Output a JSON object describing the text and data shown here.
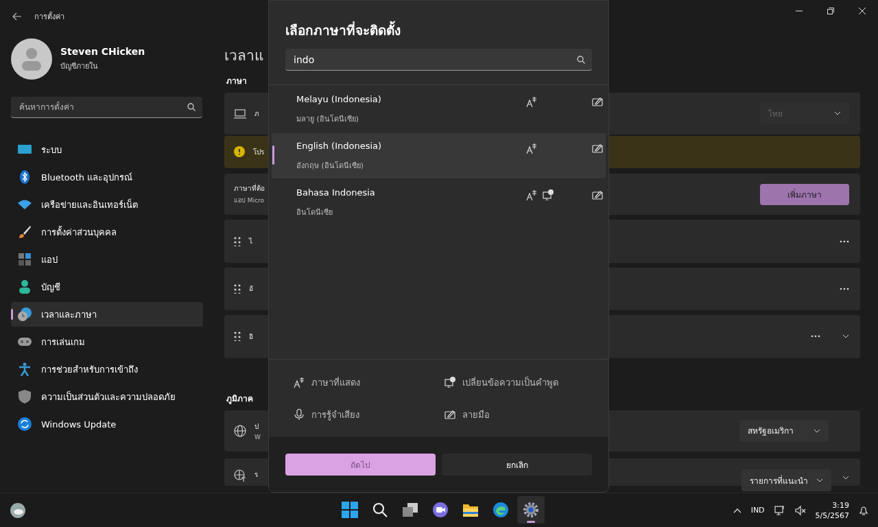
{
  "window": {
    "title": "การตั้งค่า"
  },
  "account": {
    "name": "Steven CHicken",
    "type": "บัญชีภายใน"
  },
  "search": {
    "placeholder": "ค้นหาการตั้งค่า"
  },
  "nav": [
    {
      "kind": "system",
      "label": "ระบบ",
      "selected": false
    },
    {
      "kind": "bluetooth",
      "label": "Bluetooth และอุปกรณ์",
      "selected": false
    },
    {
      "kind": "network",
      "label": "เครือข่ายและอินเทอร์เน็ต",
      "selected": false
    },
    {
      "kind": "personalize",
      "label": "การตั้งค่าส่วนบุคคล",
      "selected": false
    },
    {
      "kind": "apps",
      "label": "แอป",
      "selected": false
    },
    {
      "kind": "accounts",
      "label": "บัญชี",
      "selected": false
    },
    {
      "kind": "time",
      "label": "เวลาและภาษา",
      "selected": true
    },
    {
      "kind": "gaming",
      "label": "การเล่นเกม",
      "selected": false
    },
    {
      "kind": "accessibility",
      "label": "การช่วยสำหรับการเข้าถึง",
      "selected": false
    },
    {
      "kind": "privacy",
      "label": "ความเป็นส่วนตัวและความปลอดภัย",
      "selected": false
    },
    {
      "kind": "update",
      "label": "Windows Update",
      "selected": false
    }
  ],
  "page": {
    "title": "เวลาแ",
    "language_header": "ภาษา",
    "display_row": {
      "title": "ภ",
      "dropdown": {
        "value": "ไทย",
        "disabled": true
      }
    },
    "warning": {
      "text": "โปร"
    },
    "preferred": {
      "title": "ภาษาที่ต้อ",
      "subtitle": "แอป Micro",
      "button": "เพิ่มภาษา"
    },
    "languages": [
      {
        "title": "ไ",
        "expandable": false
      },
      {
        "title": "อั",
        "expandable": false
      },
      {
        "title": "อิ",
        "expandable": true
      }
    ],
    "region_header": "ภูมิภาค",
    "region_rows": [
      {
        "kind": "globe",
        "title": "ป",
        "subtitle": "W",
        "value": "สหรัฐอเมริกา",
        "expandable": false
      },
      {
        "kind": "format",
        "title": "ร",
        "value": "รายการที่แนะนำ",
        "expandable": true
      }
    ]
  },
  "dialog": {
    "title": "เลือกภาษาที่จะติดตั้ง",
    "search_value": "indo",
    "results": [
      {
        "name": "Melayu (Indonesia)",
        "native": "มลายู (อินโดนีเซีย)",
        "display": true,
        "tts": false,
        "handwriting": true,
        "selected": false
      },
      {
        "name": "English (Indonesia)",
        "native": "อังกฤษ (อินโดนีเซีย)",
        "display": true,
        "tts": false,
        "handwriting": true,
        "selected": true
      },
      {
        "name": "Bahasa Indonesia",
        "native": "อินโดนีเซีย",
        "display": true,
        "tts": true,
        "handwriting": true,
        "selected": false
      }
    ],
    "legend": [
      {
        "kind": "display",
        "label": "ภาษาที่แสดง"
      },
      {
        "kind": "tts",
        "label": "เปลี่ยนข้อความเป็นคำพูด"
      },
      {
        "kind": "speech",
        "label": "การรู้จำเสียง"
      },
      {
        "kind": "handwriting",
        "label": "ลายมือ"
      }
    ],
    "buttons": [
      {
        "kind": "primary",
        "label": "ถัดไป",
        "disabled": true
      },
      {
        "kind": "secondary",
        "label": "ยกเลิก",
        "disabled": false
      }
    ]
  },
  "taskbar": {
    "apps": [
      {
        "kind": "start",
        "selected": false
      },
      {
        "kind": "search",
        "selected": false
      },
      {
        "kind": "taskview",
        "selected": false
      },
      {
        "kind": "chat",
        "selected": false
      },
      {
        "kind": "explorer",
        "selected": false
      },
      {
        "kind": "edge",
        "selected": false
      },
      {
        "kind": "settings",
        "selected": true
      }
    ],
    "language": "IND",
    "time": "3:19",
    "date": "5/5/2567"
  }
}
